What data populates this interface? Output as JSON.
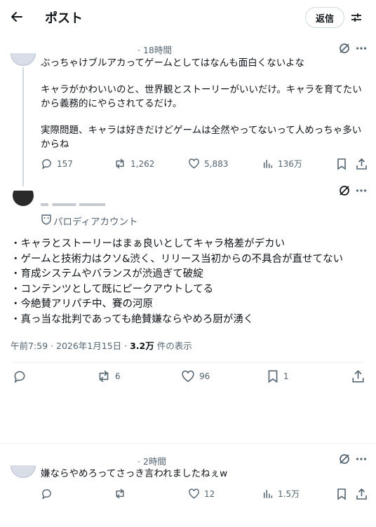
{
  "header": {
    "title": "ポスト",
    "reply_label": "返信"
  },
  "post1": {
    "time": "· 18時間",
    "lines": [
      "ぶっちゃけブルアカってゲームとしてはなんも面白くないよな",
      "キャラがかわいいのと、世界観とストーリーがいいだけ。キャラを育てたい",
      "から義務的にやらされてるだけ。",
      "実際問題、キャラは好きだけどゲームは全然やってないって人めっちゃ多い",
      "からね"
    ],
    "replies": "157",
    "reposts": "1,262",
    "likes": "5,883",
    "views": "136万"
  },
  "main": {
    "parody_label": "パロディアカウント",
    "bullets": [
      "・キャラとストーリーはまぁ良いとしてキャラ格差がデカい",
      "・ゲームと技術力はクソ&渋く、リリース当初からの不具合が直せてない",
      "・育成システムやバランスが渋過ぎて破綻",
      "・コンテンツとして既にピークアウトしてる",
      "・今絶賛アリパチ中、賽の河原",
      "・真っ当な批判であっても絶賛嫌ならやめろ厨が湧く"
    ],
    "timestamp": "午前7:59 · 2026年1月15日 · ",
    "view_count": "3.2万",
    "view_suffix": " 件の表示",
    "reposts": "6",
    "likes": "96",
    "bookmarks": "1"
  },
  "post3": {
    "time": "· 2時間",
    "text": "嫌ならやめろってさっき言われましたねぇw",
    "likes": "12",
    "views": "1.5万"
  }
}
